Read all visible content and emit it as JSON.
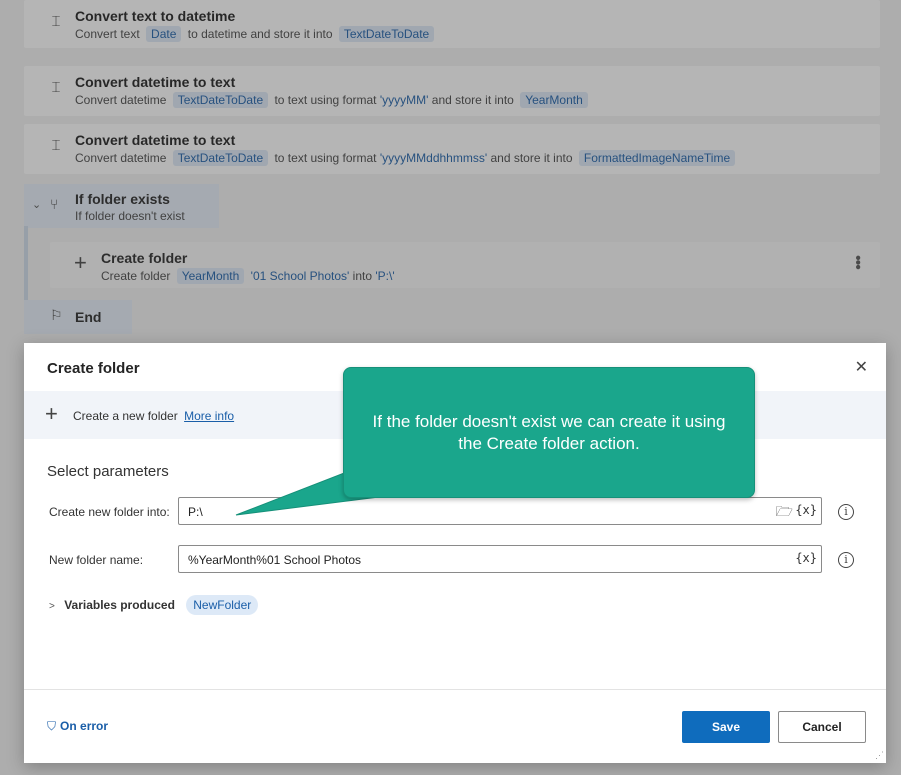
{
  "flow": {
    "actions": [
      {
        "title": "Convert text to datetime",
        "parts": [
          "Convert text",
          "Date",
          "to datetime and store it into",
          "TextDateToDate"
        ]
      },
      {
        "title": "Convert datetime to text",
        "parts": [
          "Convert datetime",
          "TextDateToDate",
          "to text using format",
          "'yyyyMM'",
          "and store it into",
          "YearMonth"
        ]
      },
      {
        "title": "Convert datetime to text",
        "parts": [
          "Convert datetime",
          "TextDateToDate",
          "to text using format",
          "'yyyyMMddhhmmss'",
          "and store it into",
          "FormattedImageNameTime"
        ]
      }
    ],
    "if_block": {
      "title": "If folder exists",
      "desc": "If folder  doesn't exist"
    },
    "nested": {
      "title": "Create folder",
      "parts": [
        "Create folder",
        "YearMonth",
        "'01 School Photos'",
        "into",
        "'P:\\'"
      ]
    },
    "end": {
      "title": "End"
    }
  },
  "dialog": {
    "title": "Create folder",
    "info": {
      "text": "Create a new folder",
      "link": "More info"
    },
    "section": "Select parameters",
    "fields": {
      "folder_into": {
        "label": "Create new folder into:",
        "value": "P:\\",
        "var_btn": "{x}"
      },
      "folder_name": {
        "label": "New folder name:",
        "value": "%YearMonth%01 School Photos",
        "var_btn": "{x}"
      }
    },
    "variables": {
      "label": "Variables produced",
      "chip": "NewFolder"
    },
    "on_error": "On error",
    "save": "Save",
    "cancel": "Cancel"
  },
  "callout": {
    "text": "If the folder doesn't exist we can create it using the Create folder action."
  },
  "colors": {
    "accent": "#0f6cbd",
    "callout": "#1aa68c",
    "chip_bg": "#dde9f7",
    "chip_text": "#1a5ea8"
  },
  "icons": {
    "convert": "datetime-convert-icon",
    "if": "branch-icon",
    "create": "plus-icon",
    "end": "flag-icon",
    "close": "close-icon",
    "folder": "folder-open-icon",
    "info": "info-icon",
    "shield": "shield-icon"
  }
}
